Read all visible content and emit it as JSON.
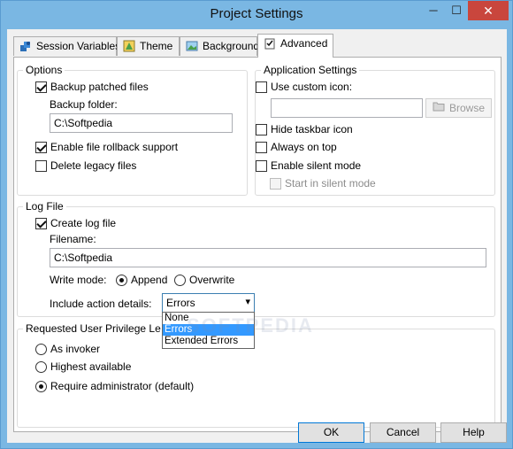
{
  "window": {
    "title": "Project Settings",
    "minimize_glyph": "─",
    "maximize_glyph": "☐",
    "close_glyph": "✕"
  },
  "tabs": [
    {
      "label": "Session Variables",
      "icon": "session-variables-icon"
    },
    {
      "label": "Theme",
      "icon": "theme-icon"
    },
    {
      "label": "Background",
      "icon": "background-icon"
    },
    {
      "label": "Advanced",
      "icon": "advanced-icon"
    }
  ],
  "active_tab": "Advanced",
  "options": {
    "legend": "Options",
    "backup_patched": {
      "label": "Backup patched files",
      "checked": true
    },
    "backup_folder_label": "Backup folder:",
    "backup_folder_value": "C:\\Softpedia",
    "rollback": {
      "label": "Enable file rollback support",
      "checked": true
    },
    "delete_legacy": {
      "label": "Delete legacy files",
      "checked": false
    }
  },
  "app_settings": {
    "legend": "Application Settings",
    "custom_icon": {
      "label": "Use custom icon:",
      "checked": false
    },
    "custom_icon_value": "",
    "browse_label": "Browse",
    "hide_taskbar": {
      "label": "Hide taskbar icon",
      "checked": false
    },
    "always_on_top": {
      "label": "Always on top",
      "checked": false
    },
    "silent_mode": {
      "label": "Enable silent mode",
      "checked": false
    },
    "start_silent": {
      "label": "Start in silent mode",
      "checked": false,
      "disabled": true
    }
  },
  "log_file": {
    "legend": "Log File",
    "create_log": {
      "label": "Create log file",
      "checked": true
    },
    "filename_label": "Filename:",
    "filename_value": "C:\\Softpedia",
    "write_mode_label": "Write mode:",
    "write_modes": [
      {
        "label": "Append",
        "checked": true
      },
      {
        "label": "Overwrite",
        "checked": false
      }
    ],
    "action_details_label": "Include action details:",
    "action_details_selected": "Errors",
    "action_details_options": [
      "None",
      "Errors",
      "Extended Errors"
    ]
  },
  "privilege": {
    "legend": "Requested User Privilege Le",
    "options": [
      {
        "label": "As invoker",
        "checked": false
      },
      {
        "label": "Highest available",
        "checked": false
      },
      {
        "label": "Require administrator (default)",
        "checked": true
      }
    ]
  },
  "watermark": "SOFTPEDIA",
  "footer": {
    "ok": "OK",
    "cancel": "Cancel",
    "help": "Help"
  },
  "colors": {
    "accent": "#0078d7",
    "selection": "#3399ff",
    "close_button": "#c9463d"
  }
}
